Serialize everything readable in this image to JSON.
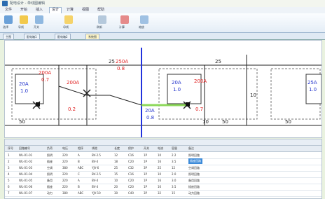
{
  "window": {
    "title": "配电设计 - 单线图编辑"
  },
  "ribbon_tabs": [
    "文件",
    "开始",
    "插入",
    "设计",
    "计算",
    "视图",
    "帮助"
  ],
  "ribbon_labels": [
    "选择",
    "导线",
    "开关",
    "母线",
    "刷新",
    "计算",
    "缩放"
  ],
  "sheet_tabs": [
    "主图",
    "配电箱1",
    "配电箱2",
    "系统图"
  ],
  "active_sheet_index": 3,
  "diagram": {
    "labels_red": [
      "200A",
      "0.7",
      "200A",
      "0.2",
      "250A",
      "0.8",
      "200A",
      "0.7"
    ],
    "labels_blue": [
      "20A",
      "1.0",
      "20A",
      "0.8",
      "20A",
      "1.0",
      "25A",
      "1.0"
    ],
    "labels_black": [
      "25",
      "25",
      "10",
      "10",
      "50",
      "50",
      "50"
    ]
  },
  "table": {
    "headers": [
      "序号",
      "回路编号",
      "负荷",
      "电压",
      "相序",
      "线缆",
      "长度",
      "保护",
      "开关",
      "电流",
      "容量",
      "备注"
    ],
    "rows": [
      [
        "1",
        "WL-01-01",
        "照明",
        "220",
        "A",
        "BV-2.5",
        "12",
        "C16",
        "1P",
        "10",
        "2.2",
        "照明回路"
      ],
      [
        "2",
        "WL-01-02",
        "插座",
        "220",
        "B",
        "BV-4",
        "18",
        "C20",
        "1P",
        "16",
        "3.5",
        "插座回路"
      ],
      [
        "3",
        "WL-01-03",
        "空调",
        "380",
        "ABC",
        "YJV-6",
        "25",
        "C32",
        "3P",
        "25",
        "12",
        "空调回路"
      ],
      [
        "4",
        "WL-01-04",
        "照明",
        "220",
        "C",
        "BV-2.5",
        "15",
        "C16",
        "1P",
        "10",
        "2.0",
        "照明回路"
      ],
      [
        "5",
        "WL-01-05",
        "备用",
        "220",
        "A",
        "BV-4",
        "10",
        "C20",
        "1P",
        "16",
        "3.0",
        "备用回路"
      ],
      [
        "6",
        "WL-01-06",
        "插座",
        "220",
        "B",
        "BV-4",
        "20",
        "C20",
        "1P",
        "16",
        "3.5",
        "插座回路"
      ],
      [
        "7",
        "WL-01-07",
        "动力",
        "380",
        "ABC",
        "YJV-10",
        "30",
        "C40",
        "3P",
        "32",
        "15",
        "动力回路"
      ]
    ],
    "selected_cell": "插座回路"
  },
  "colors": {
    "accent": "#2b6cb0",
    "selection": "#3d8bd9",
    "wire_green": "#8cd85a",
    "red": "#e02020"
  }
}
